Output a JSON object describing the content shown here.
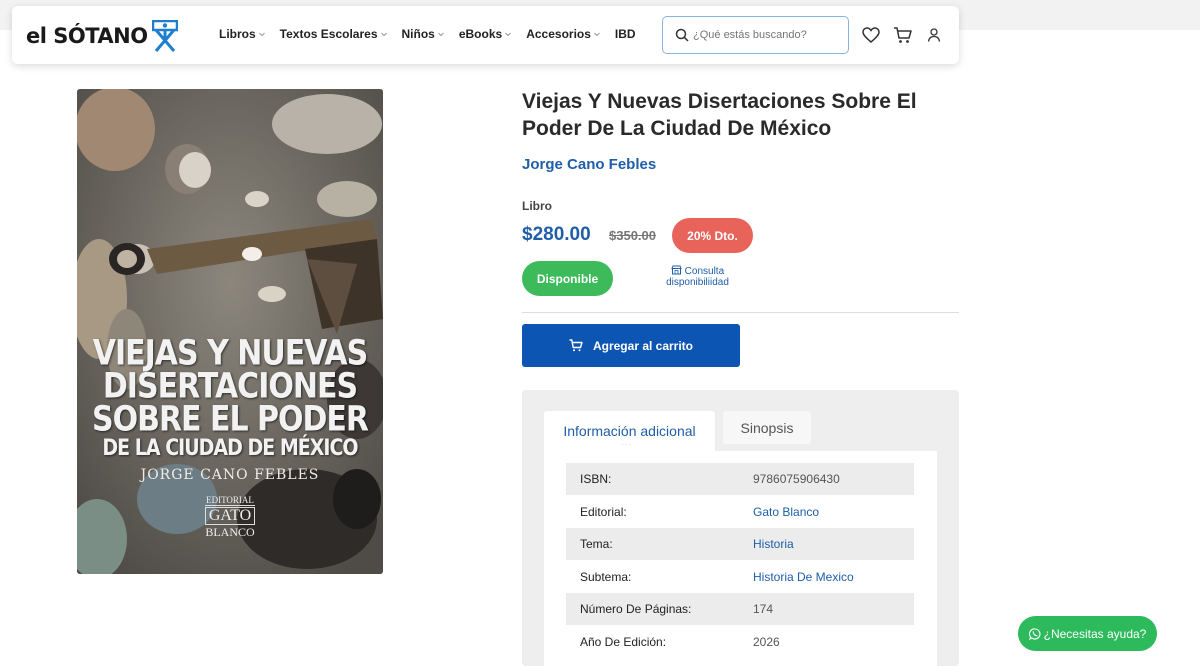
{
  "header": {
    "logo_text": "el SÓTANO",
    "nav": [
      {
        "label": "Libros",
        "has_menu": true
      },
      {
        "label": "Textos Escolares",
        "has_menu": true
      },
      {
        "label": "Niños",
        "has_menu": true
      },
      {
        "label": "eBooks",
        "has_menu": true
      },
      {
        "label": "Accesorios",
        "has_menu": true
      },
      {
        "label": "IBD",
        "has_menu": false
      }
    ],
    "search_placeholder": "¿Qué estás buscando?",
    "icons": [
      "heart-icon",
      "cart-icon",
      "user-icon"
    ]
  },
  "cover": {
    "title_lines": [
      "VIEJAS Y NUEVAS",
      "DISERTACIONES",
      "SOBRE EL PODER",
      "DE LA CIUDAD DE MÉXICO"
    ],
    "author": "JORGE CANO FEBLES",
    "publisher_lines": [
      "EDITORIAL",
      "GATO",
      "BLANCO"
    ]
  },
  "product": {
    "title": "Viejas Y Nuevas Disertaciones Sobre El Poder De La Ciudad De México",
    "author": "Jorge Cano Febles",
    "format": "Libro",
    "price": "$280.00",
    "old_price": "$350.00",
    "discount": "20% Dto.",
    "availability": "Disponible",
    "consult": "Consulta disponibiliidad",
    "add_to_cart": "Agregar al carrito"
  },
  "tabs": [
    {
      "label": "Información adicional",
      "active": true
    },
    {
      "label": "Sinopsis",
      "active": false
    }
  ],
  "details": [
    {
      "label": "ISBN:",
      "value": "9786075906430",
      "link": false
    },
    {
      "label": "Editorial:",
      "value": "Gato Blanco",
      "link": true
    },
    {
      "label": "Tema:",
      "value": "Historia",
      "link": true
    },
    {
      "label": "Subtema:",
      "value": "Historia De Mexico",
      "link": true
    },
    {
      "label": "Número De Páginas:",
      "value": "174",
      "link": false
    },
    {
      "label": "Año De Edición:",
      "value": "2026",
      "link": false
    }
  ],
  "help_button": "¿Necesitas ayuda?",
  "colors": {
    "brand_blue": "#1f5ea8",
    "cart_button": "#0d55b3",
    "discount": "#e8645a",
    "available": "#3dbb5b",
    "whatsapp": "#2dba5d"
  }
}
